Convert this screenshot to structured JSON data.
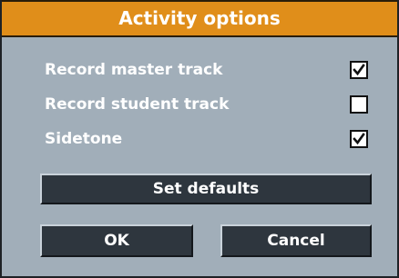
{
  "dialog": {
    "title": "Activity options"
  },
  "options": [
    {
      "label": "Record master track",
      "checked": true
    },
    {
      "label": "Record student track",
      "checked": false
    },
    {
      "label": "Sidetone",
      "checked": true
    }
  ],
  "buttons": {
    "set_defaults": "Set defaults",
    "ok": "OK",
    "cancel": "Cancel"
  },
  "colors": {
    "title_bar": "#e08e1a",
    "panel": "#a1aeb9",
    "button": "#2e363e",
    "text": "#ffffff"
  },
  "icons": {
    "checked": "checkmark-icon"
  }
}
